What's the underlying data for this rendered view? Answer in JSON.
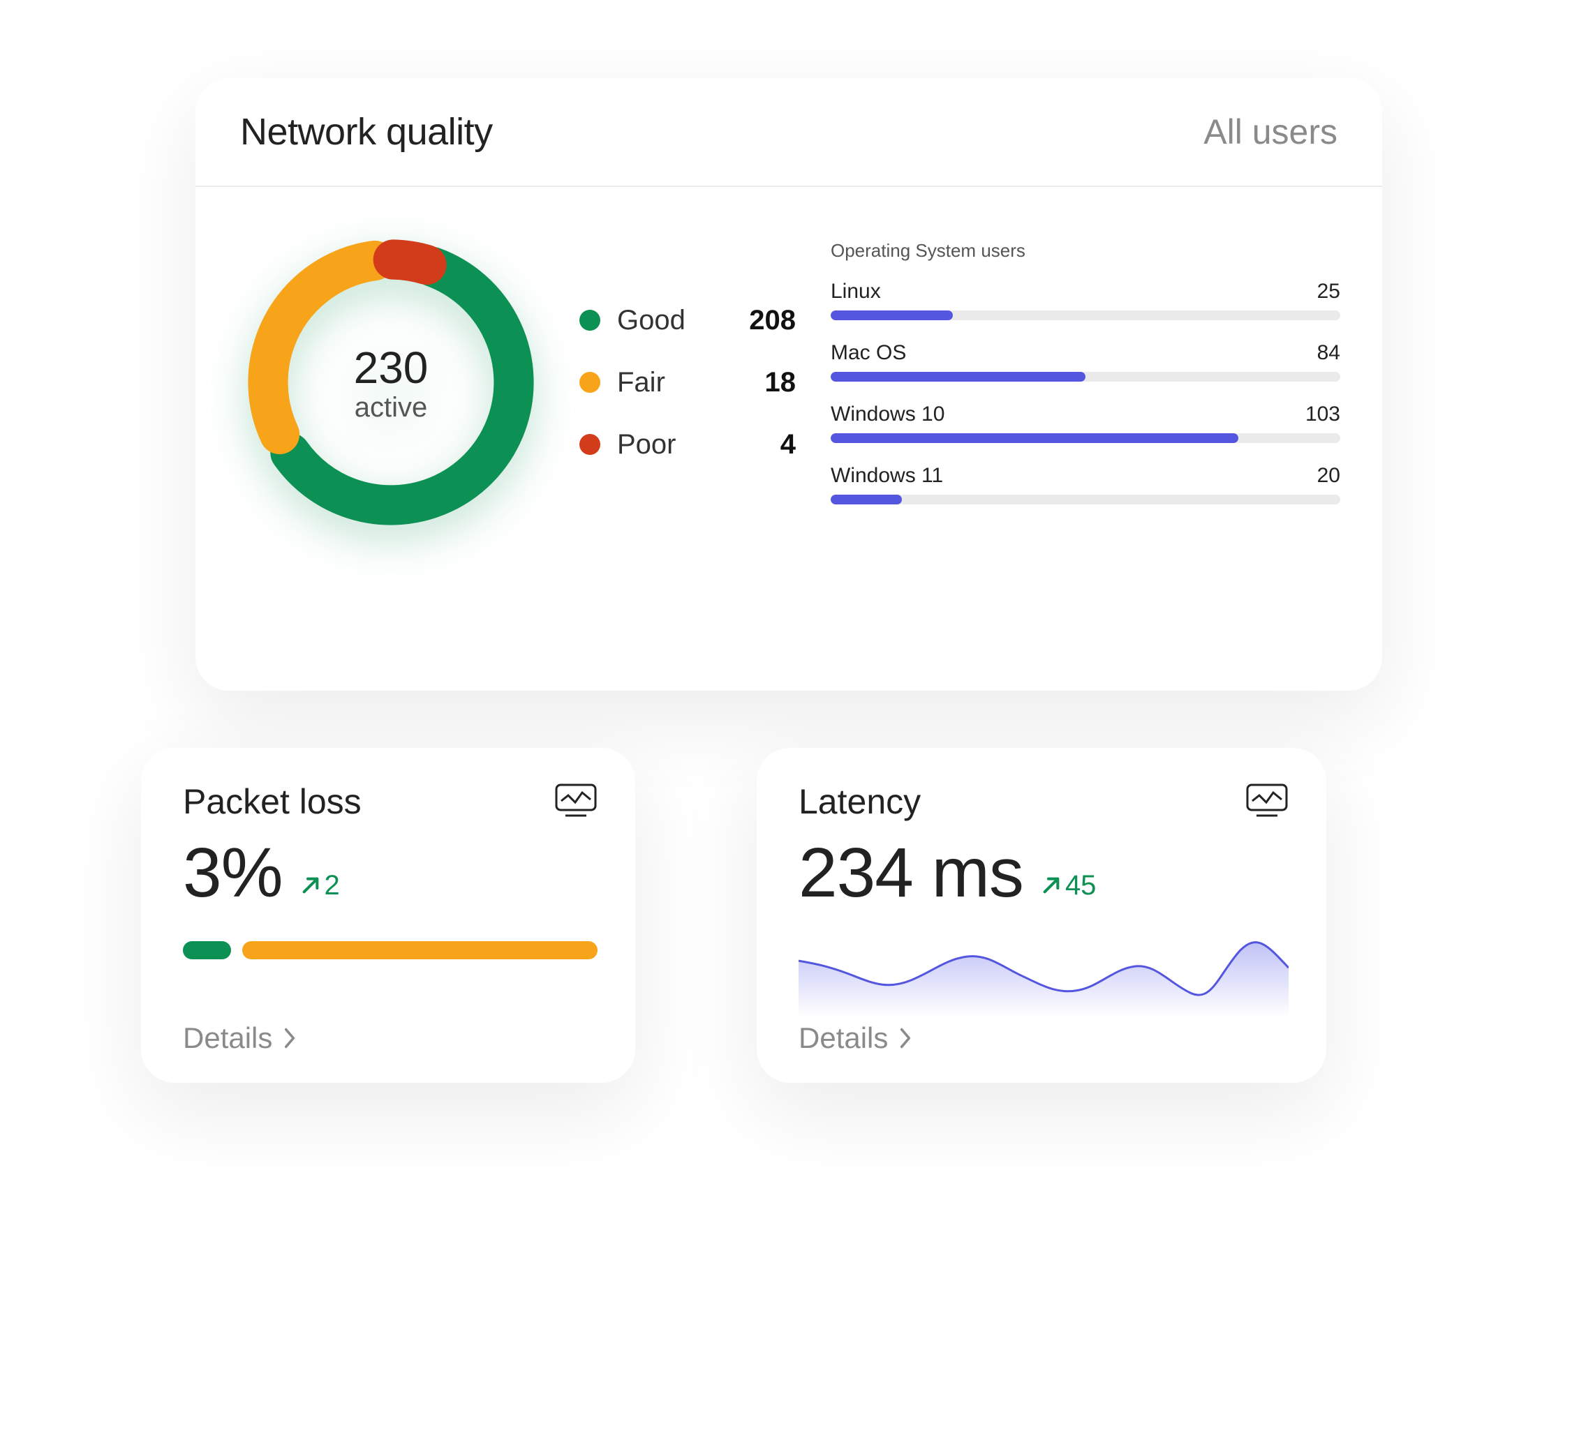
{
  "colors": {
    "good": "#0d9053",
    "fair": "#f7a41a",
    "poor": "#d33c1a",
    "series": "#5456e0"
  },
  "network_quality": {
    "title": "Network quality",
    "filter_label": "All users",
    "donut": {
      "value": "230",
      "label": "active"
    },
    "legend": [
      {
        "name": "Good",
        "value": "208",
        "color": "#0d9053"
      },
      {
        "name": "Fair",
        "value": "18",
        "color": "#f7a41a"
      },
      {
        "name": "Poor",
        "value": "4",
        "color": "#d33c1a"
      }
    ],
    "os": {
      "title": "Operating System users",
      "rows": [
        {
          "name": "Linux",
          "value": "25",
          "pct": 24
        },
        {
          "name": "Mac OS",
          "value": "84",
          "pct": 50
        },
        {
          "name": "Windows 10",
          "value": "103",
          "pct": 80
        },
        {
          "name": "Windows 11",
          "value": "20",
          "pct": 14
        }
      ]
    }
  },
  "packet_loss": {
    "title": "Packet loss",
    "value": "3%",
    "trend": "2",
    "details_label": "Details",
    "bar": {
      "green_pct": 12,
      "orange_pct": 88
    }
  },
  "latency": {
    "title": "Latency",
    "value": "234 ms",
    "trend": "45",
    "details_label": "Details"
  },
  "chart_data": [
    {
      "type": "pie",
      "title": "Network quality",
      "series": [
        {
          "name": "Good",
          "value": 208,
          "color": "#0d9053"
        },
        {
          "name": "Fair",
          "value": 18,
          "color": "#f7a41a"
        },
        {
          "name": "Poor",
          "value": 4,
          "color": "#d33c1a"
        }
      ],
      "center_label": {
        "value": 230,
        "text": "active"
      }
    },
    {
      "type": "bar",
      "title": "Operating System users",
      "categories": [
        "Linux",
        "Mac OS",
        "Windows 10",
        "Windows 11"
      ],
      "values": [
        25,
        84,
        103,
        20
      ],
      "xlabel": "",
      "ylabel": ""
    },
    {
      "type": "bar",
      "title": "Packet loss",
      "categories": [
        "good",
        "loss"
      ],
      "values": [
        12,
        88
      ],
      "unit": "%"
    },
    {
      "type": "area",
      "title": "Latency",
      "x": [
        0,
        1,
        2,
        3,
        4,
        5,
        6,
        7,
        8,
        9,
        10,
        11,
        12,
        13,
        14,
        15,
        16,
        17,
        18,
        19
      ],
      "values": [
        60,
        55,
        50,
        40,
        35,
        45,
        55,
        65,
        55,
        40,
        30,
        35,
        50,
        45,
        35,
        25,
        40,
        70,
        75,
        55
      ],
      "ylabel": "ms"
    }
  ]
}
